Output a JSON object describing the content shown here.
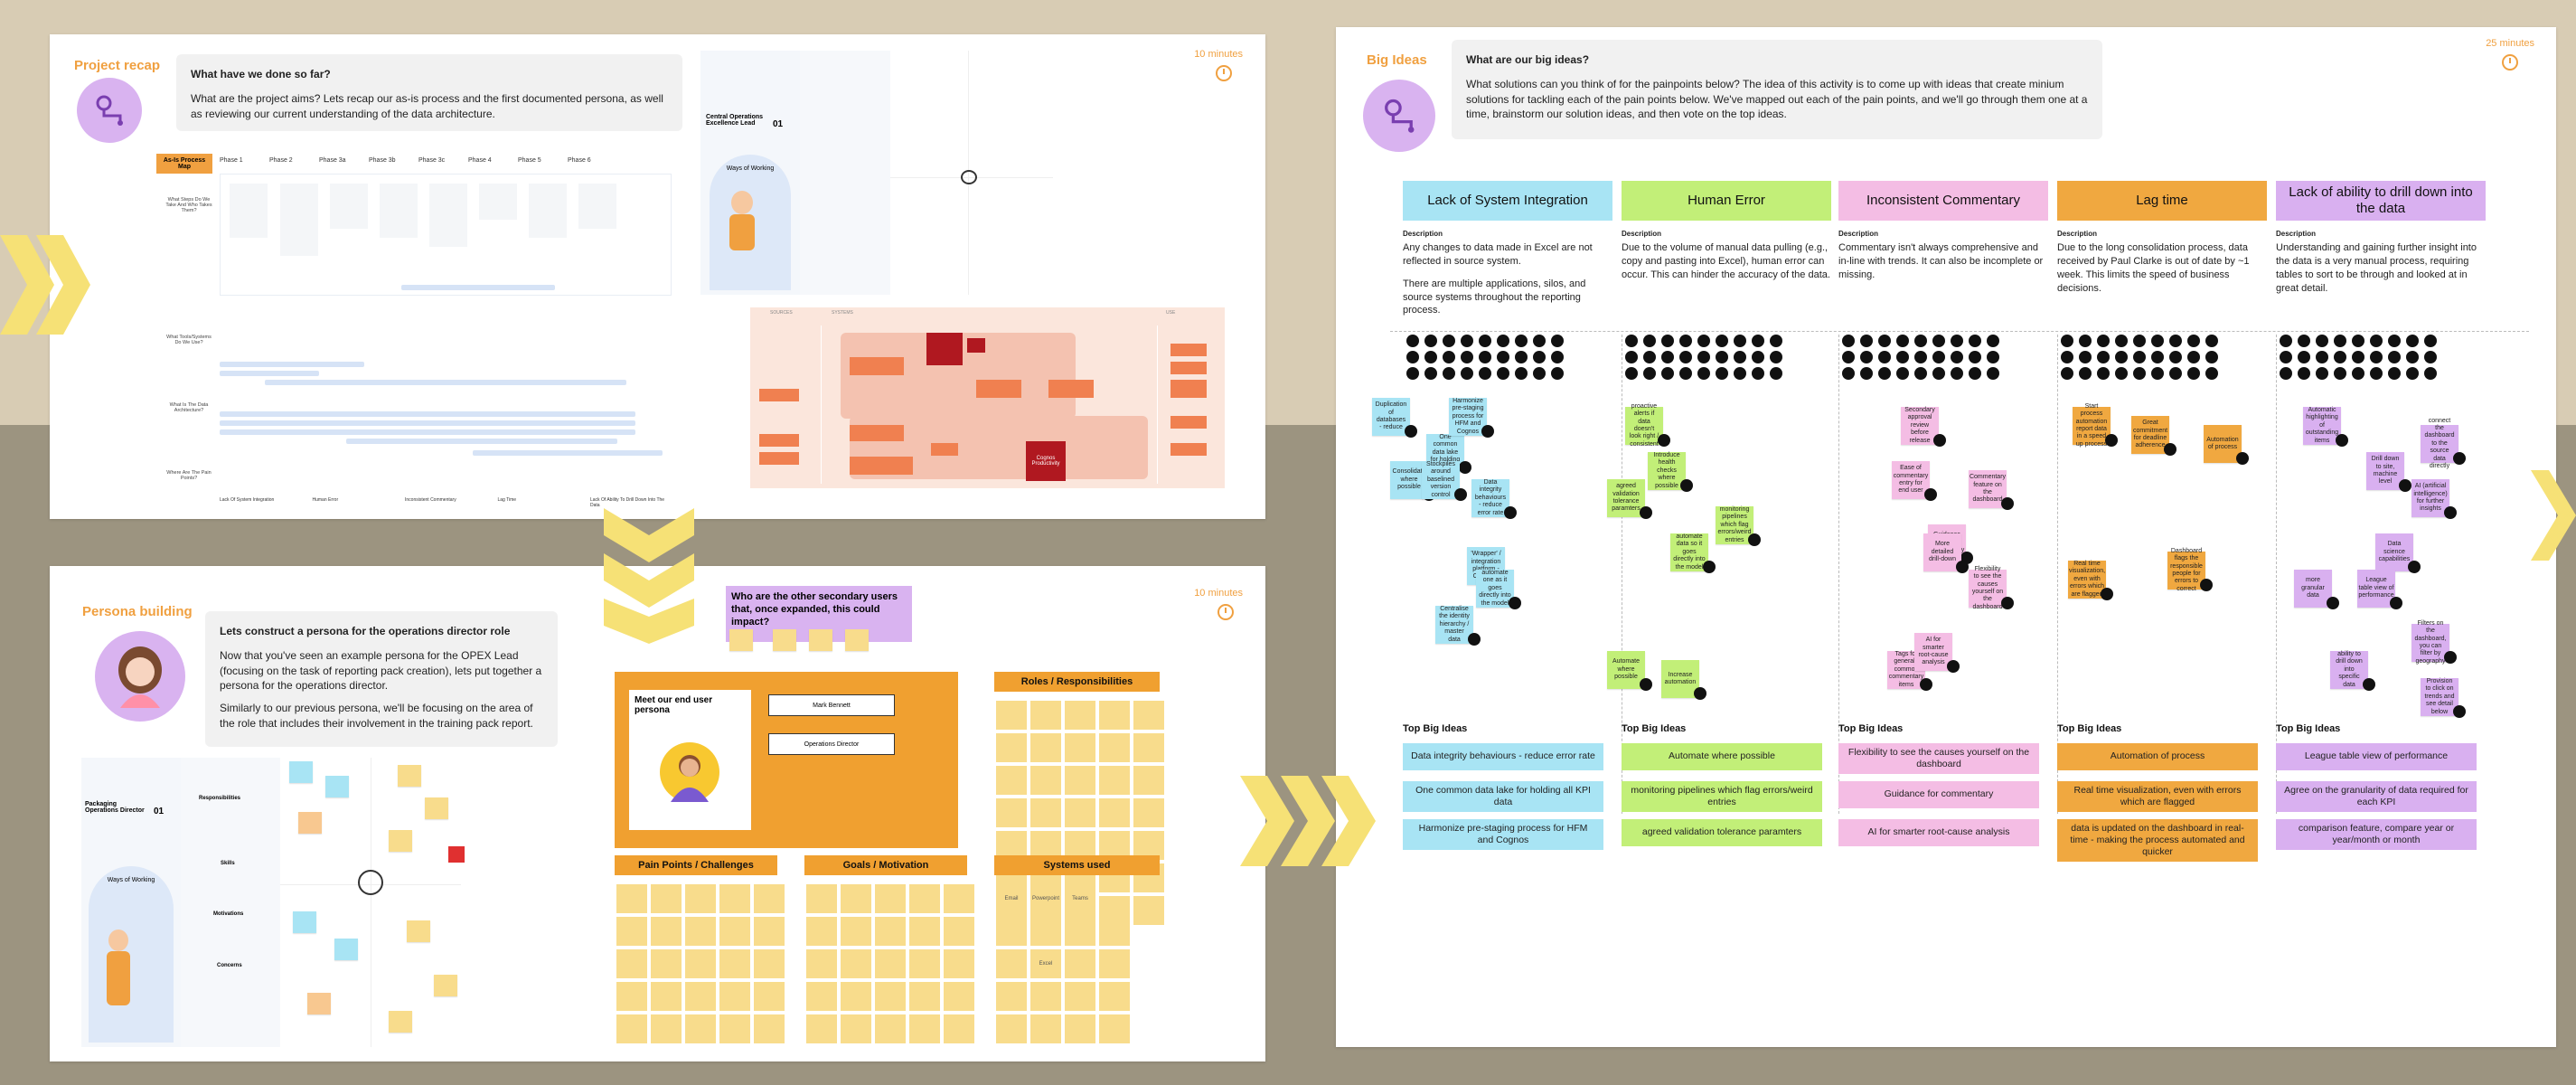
{
  "colors": {
    "accent_orange": "#f0a040",
    "avatar_purple": "#d9b3f0",
    "chevron_yellow": "#f6e176",
    "blue": "#a8e4f4",
    "green": "#c2ef78",
    "pink": "#f4bde4",
    "orange": "#f0a840",
    "purple": "#d9b0f0"
  },
  "recap": {
    "title": "Project recap",
    "timer": "10 minutes",
    "prompt_heading": "What have we done so far?",
    "prompt_body": "What are the project aims? Lets recap our as-is process and the first documented persona, as well as reviewing our current understanding of the data architecture.",
    "map_label": "As-Is Process Map",
    "phases": [
      "Phase 1",
      "Phase 2",
      "Phase 3a",
      "Phase 3b",
      "Phase 3c",
      "Phase 4",
      "Phase 5",
      "Phase 6"
    ],
    "row_labels": [
      "What Steps Do We Take And Who Takes Them?",
      "What Tools/Systems Do We Use?",
      "What Is The Data Architecture?",
      "Where Are The Pain Points?"
    ],
    "painpoints": [
      "Lack Of System Integration",
      "Human Error",
      "Inconsistent Commentary",
      "Lag Time",
      "Lack Of Ability To Drill Down Into The Data"
    ],
    "persona_card_title": "Central Operations Excellence Lead",
    "persona_card_number": "01",
    "ways_of_working": "Ways of Working",
    "arch_sources": "SOURCES",
    "arch_systems": "SYSTEMS",
    "arch_use": "USE",
    "arch_nodes": [
      "Cognos",
      "Productivity"
    ]
  },
  "persona": {
    "title": "Persona building",
    "timer": "10 minutes",
    "prompt_heading": "Lets construct a persona for the operations director role",
    "prompt_p1": "Now that you've seen an example persona for the OPEX Lead (focusing on the task of reporting pack creation), lets put together a persona for the operations director.",
    "prompt_p2": "Similarly to our previous persona, we'll be focusing on the area of the role that includes their involvement in the training pack report.",
    "card_title": "Packaging Operations Director",
    "card_number": "01",
    "ways_of_working": "Ways of Working",
    "sections": [
      "Skills",
      "Responsibilities",
      "Motivations",
      "Concerns"
    ],
    "secondary_users": "Who are the other secondary users that, once expanded, this could impact?",
    "meet_user": "Meet our end user persona",
    "user_name": "Mark Bennett",
    "user_role": "Operations Director",
    "roles": "Roles / Responsibilities",
    "pain": "Pain Points / Challenges",
    "goals": "Goals / Motivation",
    "systems": "Systems used",
    "systems_items": [
      "Email",
      "Powerpoint",
      "Teams",
      "Excel"
    ]
  },
  "bigideas": {
    "title": "Big Ideas",
    "timer": "25 minutes",
    "prompt_heading": "What are our big ideas?",
    "prompt_body": "What solutions can you think of for the painpoints below? The idea of this activity is to come up with ideas that create minium solutions for tackling each of the pain points below. We've mapped out each of the pain points, and we'll go through them one at a time, brainstorm our solution ideas, and then vote on the top ideas.",
    "desc_label": "Description",
    "top_label": "Top Big Ideas",
    "columns": [
      {
        "title": "Lack of System Integration",
        "desc1": "Any changes to data made in Excel are not reflected in source system.",
        "desc2": "There are multiple applications, silos, and source systems throughout the reporting process.",
        "top": [
          "Data integrity behaviours - reduce error rate",
          "One common data lake for holding all KPI data",
          "Harmonize pre-staging process for HFM and Cognos"
        ],
        "stickies": [
          "Duplication of databases - reduce",
          "One common data lake for holding all KPI",
          "Consolidate where possible",
          "Harmonize pre-staging process for HFM and Cognos",
          "Stockpiles around baselined version control",
          "Data integrity behaviours - reduce error rate",
          "'Wrapper' / integration platform - CERTUS",
          "Centralise the identity hierarchy / master data",
          "automate one as it goes directly into the model"
        ]
      },
      {
        "title": "Human Error",
        "desc1": "Due to the volume of manual data pulling (e.g., copy and pasting into Excel), human error can occur. This can hinder the accuracy of the data.",
        "desc2": "",
        "top": [
          "Automate where possible",
          "monitoring pipelines which flag errors/weird entries",
          "agreed validation tolerance paramters"
        ],
        "stickies": [
          "proactive alerts if data doesn't look right / consistent",
          "Introduce health checks where possible",
          "agreed validation tolerance paramters",
          "monitoring pipelines which flag errors/weird entries",
          "Automate where possible",
          "Increase automation",
          "automate data so it goes directly into the model"
        ]
      },
      {
        "title": "Inconsistent Commentary",
        "desc1": "Commentary isn't always comprehensive and in-line with trends. It can also be incomplete or missing.",
        "desc2": "",
        "top": [
          "Flexibility to see the causes yourself on the dashboard",
          "Guidance for commentary",
          "AI for smarter root-cause analysis"
        ],
        "stickies": [
          "Secondary approval review before release",
          "Ease of commentary entry for end user",
          "Guidance for commentary",
          "Commentary feature on the dashboard",
          "Flexibility to see the causes yourself on the dashboard",
          "Tags for general / common commentary items",
          "AI for smarter root-cause analysis",
          "More detailed drill-down"
        ]
      },
      {
        "title": "Lag time",
        "desc1": "Due to the long consolidation process, data received by Paul Clarke is out of date by ~1 week. This limits the speed of business decisions.",
        "desc2": "",
        "top": [
          "Automation of process",
          "Real time visualization, even with errors which are flagged",
          "data is updated on the dashboard in real-time - making the process automated and quicker"
        ],
        "stickies": [
          "Start process automation report data in a speed up process",
          "Great commitment for deadline adherence",
          "Automation of process",
          "Real time visualization, even with errors which are flagged",
          "Dashboard flags the responsible people for errors to correct"
        ]
      },
      {
        "title": "Lack of ability to drill down into the data",
        "desc1": "Understanding and gaining further insight into the data is a very manual process, requiring tables to sort to be through and looked at in great detail.",
        "desc2": "",
        "top": [
          "League table view of performance",
          "Agree on the granularity of data required for each KPI",
          "comparison feature, compare year or year/month or month"
        ],
        "stickies": [
          "Automatic highlighting of outstanding items",
          "Drill down to site, machine level",
          "connect the dashboard to the source data directly",
          "AI (artificial intelligence) for further insights",
          "Data science capabilities",
          "more granular data",
          "League table view of performance",
          "ability to drill down into specific data",
          "Filters on the dashboard, you can filter by geography",
          "Provision to click on trends and see detail below"
        ]
      }
    ]
  }
}
